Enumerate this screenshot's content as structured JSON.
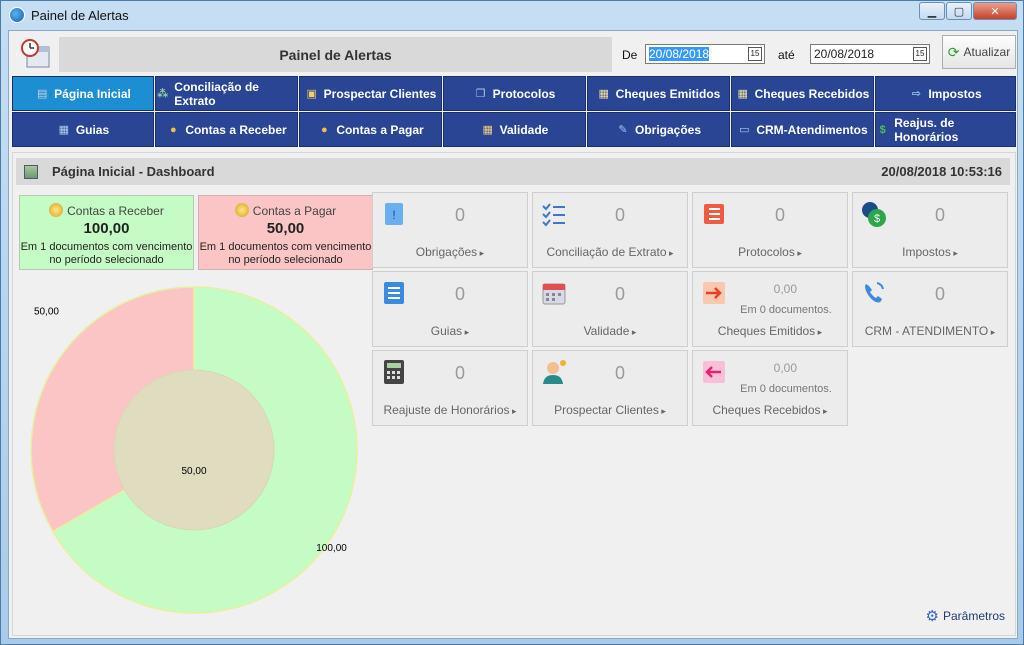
{
  "window": {
    "title": "Painel de Alertas"
  },
  "header": {
    "title": "Painel de Alertas",
    "from_label": "De",
    "from_date": "20/08/2018",
    "to_label": "até",
    "to_date": "20/08/2018",
    "refresh_label": "Atualizar"
  },
  "nav": [
    {
      "label": "Página Inicial",
      "icon": "building-icon",
      "active": true
    },
    {
      "label": "Conciliação de Extrato",
      "icon": "hierarchy-icon"
    },
    {
      "label": "Prospectar Clientes",
      "icon": "briefcase-icon"
    },
    {
      "label": "Protocolos",
      "icon": "documents-icon"
    },
    {
      "label": "Cheques Emitidos",
      "icon": "cheque-out-icon"
    },
    {
      "label": "Cheques Recebidos",
      "icon": "cheque-in-icon"
    },
    {
      "label": "Impostos",
      "icon": "tax-icon"
    },
    {
      "label": "Guias",
      "icon": "guide-icon"
    },
    {
      "label": "Contas a Receber",
      "icon": "coins-icon"
    },
    {
      "label": "Contas a Pagar",
      "icon": "coins-icon"
    },
    {
      "label": "Validade",
      "icon": "calendar-icon"
    },
    {
      "label": "Obrigações",
      "icon": "edit-icon"
    },
    {
      "label": "CRM-Atendimentos",
      "icon": "monitor-icon"
    },
    {
      "label": "Reajus. de Honorários",
      "icon": "dollar-icon"
    }
  ],
  "dashboard": {
    "title": "Página Inicial - Dashboard",
    "datetime": "20/08/2018 10:53:16",
    "receber": {
      "title": "Contas a Receber",
      "value": "100,00",
      "desc1": "Em 1 documentos com vencimento",
      "desc2": "no período selecionado"
    },
    "pagar": {
      "title": "Contas a Pagar",
      "value": "50,00",
      "desc1": "Em 1 documentos com vencimento",
      "desc2": "no período selecionado"
    },
    "params_label": "Parâmetros",
    "tiles": [
      {
        "label": "Obrigações",
        "value": "0",
        "icon": "obligation-icon"
      },
      {
        "label": "Conciliação de Extrato",
        "value": "0",
        "icon": "checklist-icon"
      },
      {
        "label": "Protocolos",
        "value": "0",
        "icon": "protocol-icon"
      },
      {
        "label": "Impostos",
        "value": "0",
        "icon": "tax-coin-icon"
      },
      {
        "label": "Guias",
        "value": "0",
        "icon": "list-icon"
      },
      {
        "label": "Validade",
        "value": "0",
        "icon": "calendar-icon"
      },
      {
        "label": "Cheques Emitidos",
        "value": "0,00",
        "sub": "Em 0 documentos.",
        "icon": "arrow-out-icon"
      },
      {
        "label": "CRM - ATENDIMENTO",
        "value": "0",
        "icon": "phone-icon"
      },
      {
        "label": "Reajuste de Honorários",
        "value": "0",
        "icon": "calculator-icon"
      },
      {
        "label": "Prospectar Clientes",
        "value": "0",
        "icon": "person-icon"
      },
      {
        "label": "Cheques Recebidos",
        "value": "0,00",
        "sub": "Em 0 documentos.",
        "icon": "arrow-in-icon"
      }
    ]
  },
  "chart_data": {
    "type": "pie",
    "outer": {
      "values": [
        100,
        50
      ],
      "labels": [
        "100,00",
        "50,00"
      ],
      "colors": [
        "#c5fcc5",
        "#fcc5c5"
      ]
    },
    "inner": {
      "values": [
        50
      ],
      "labels": [
        "50,00"
      ],
      "colors": [
        "#e0dcc0"
      ]
    }
  }
}
